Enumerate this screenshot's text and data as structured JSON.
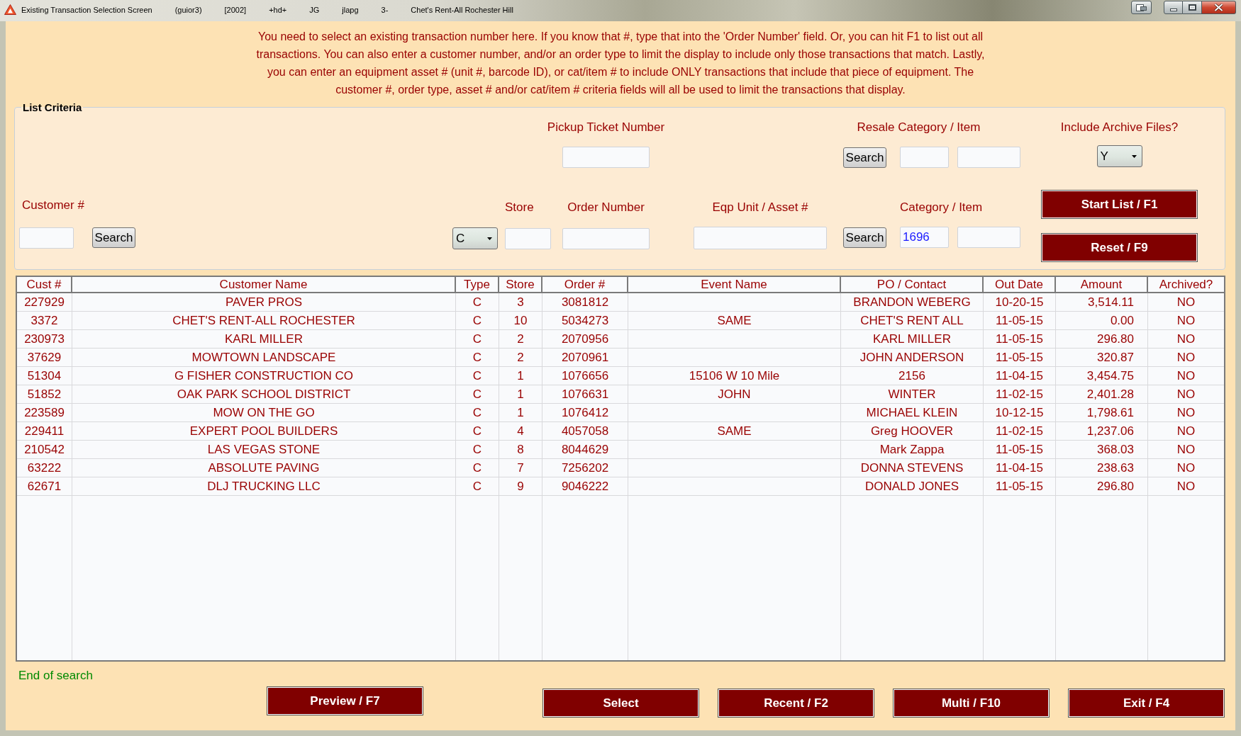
{
  "window": {
    "title": "Existing Transaction Selection Screen",
    "title_details": [
      "(guior3)",
      "[2002]",
      "+hd+",
      "JG",
      "jlapg",
      "3-",
      "Chet's Rent-All Rochester Hill"
    ]
  },
  "instructions": [
    "You need to select an existing transaction number here. If you know that #, type that into the 'Order Number' field. Or, you can hit F1 to list out all",
    "transactions. You can also enter a customer number, and/or an order type to limit the display to include only those transactions that match. Lastly,",
    "you can enter an equipment asset # (unit #, barcode ID), or cat/item # to include ONLY transactions that include that piece of equipment. The",
    "customer #, order type, asset # and/or cat/item # criteria fields will all be used to limit the transactions that display."
  ],
  "criteria": {
    "legend": "List Criteria",
    "pickup_ticket_number": {
      "label": "Pickup Ticket Number"
    },
    "resale_category_item": {
      "label": "Resale Category / Item",
      "search_button": "Search"
    },
    "include_archive_files": {
      "label": "Include Archive Files?",
      "value": "Y"
    },
    "customer_number": {
      "label": "Customer #",
      "search_button": "Search"
    },
    "order_type": {
      "value": "C"
    },
    "store": {
      "label": "Store"
    },
    "order_number": {
      "label": "Order Number"
    },
    "eqp_unit_asset": {
      "label": "Eqp Unit / Asset #",
      "search_button": "Search"
    },
    "category_item": {
      "label": "Category / Item",
      "category": "1696"
    },
    "buttons": [
      "Start List / F1",
      "Reset / F9"
    ]
  },
  "table": {
    "columns": [
      "Cust #",
      "Customer Name",
      "Type",
      "Store",
      "Order #",
      "Event Name",
      "PO / Contact",
      "Out Date",
      "Amount",
      "Archived?"
    ],
    "rows": [
      {
        "cust_no": "227929",
        "customer_name": "PAVER PROS",
        "type": "C",
        "store": "3",
        "order_no": "3081812",
        "po_contact": "BRANDON WEBERG",
        "out_date": "10-20-15",
        "amount": "3,514.11",
        "archived": "NO"
      },
      {
        "cust_no": "3372",
        "customer_name": "CHET'S RENT-ALL ROCHESTER",
        "type": "C",
        "store": "10",
        "order_no": "5034273",
        "event_name": "SAME",
        "po_contact": "CHET'S RENT ALL",
        "out_date": "11-05-15",
        "amount": "0.00",
        "archived": "NO"
      },
      {
        "cust_no": "230973",
        "customer_name": "KARL MILLER",
        "type": "C",
        "store": "2",
        "order_no": "2070956",
        "po_contact": "KARL MILLER",
        "out_date": "11-05-15",
        "amount": "296.80",
        "archived": "NO"
      },
      {
        "cust_no": "37629",
        "customer_name": "MOWTOWN LANDSCAPE",
        "type": "C",
        "store": "2",
        "order_no": "2070961",
        "po_contact": "JOHN ANDERSON",
        "out_date": "11-05-15",
        "amount": "320.87",
        "archived": "NO"
      },
      {
        "cust_no": "51304",
        "customer_name": "G FISHER CONSTRUCTION CO",
        "type": "C",
        "store": "1",
        "order_no": "1076656",
        "event_name": "15106 W 10 Mile",
        "po_contact": "2156",
        "out_date": "11-04-15",
        "amount": "3,454.75",
        "archived": "NO"
      },
      {
        "cust_no": "51852",
        "customer_name": "OAK PARK SCHOOL DISTRICT",
        "type": "C",
        "store": "1",
        "order_no": "1076631",
        "event_name": "JOHN",
        "po_contact": "WINTER",
        "out_date": "11-02-15",
        "amount": "2,401.28",
        "archived": "NO"
      },
      {
        "cust_no": "223589",
        "customer_name": "MOW ON THE GO",
        "type": "C",
        "store": "1",
        "order_no": "1076412",
        "po_contact": "MICHAEL KLEIN",
        "out_date": "10-12-15",
        "amount": "1,798.61",
        "archived": "NO"
      },
      {
        "cust_no": "229411",
        "customer_name": "EXPERT POOL BUILDERS",
        "type": "C",
        "store": "4",
        "order_no": "4057058",
        "event_name": "SAME",
        "po_contact": "Greg HOOVER",
        "out_date": "11-02-15",
        "amount": "1,237.06",
        "archived": "NO"
      },
      {
        "cust_no": "210542",
        "customer_name": "LAS VEGAS STONE",
        "type": "C",
        "store": "8",
        "order_no": "8044629",
        "po_contact": "Mark Zappa",
        "out_date": "11-05-15",
        "amount": "368.03",
        "archived": "NO"
      },
      {
        "cust_no": "63222",
        "customer_name": "ABSOLUTE PAVING",
        "type": "C",
        "store": "7",
        "order_no": "7256202",
        "po_contact": "DONNA STEVENS",
        "out_date": "11-04-15",
        "amount": "238.63",
        "archived": "NO"
      },
      {
        "cust_no": "62671",
        "customer_name": "DLJ TRUCKING LLC",
        "type": "C",
        "store": "9",
        "order_no": "9046222",
        "po_contact": "DONALD JONES",
        "out_date": "11-05-15",
        "amount": "296.80",
        "archived": "NO"
      }
    ]
  },
  "status": "End of search",
  "buttons": [
    "Preview / F7",
    "Select",
    "Recent / F2",
    "Multi / F10",
    "Exit / F4"
  ]
}
